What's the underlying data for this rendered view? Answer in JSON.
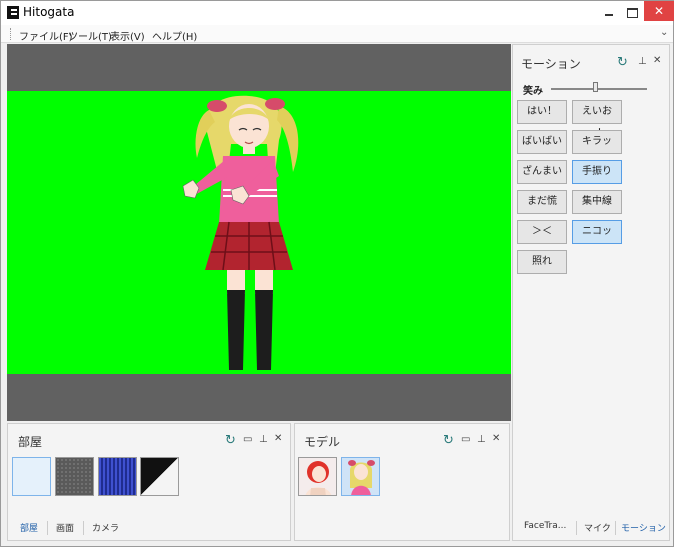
{
  "window": {
    "title": "Hitogata",
    "close_glyph": "✕"
  },
  "menu": [
    "ファイル(F)",
    "ツール(T)",
    "表示(V)",
    "ヘルプ(H)"
  ],
  "menu_overflow_glyph": "⌄",
  "panel_icons": {
    "refresh": "↻",
    "window": "▭",
    "pin": "⊥",
    "close": "✕"
  },
  "colors": {
    "chroma_key": "#00ff00",
    "viewport_bg": "#616161",
    "accent_tab": "#1f5fa8",
    "selected_button": "#cce4f7"
  },
  "motion_panel": {
    "title": "モーション",
    "slider": {
      "label": "笑み",
      "value_fraction": 0.45
    },
    "buttons": [
      {
        "label": "はい！",
        "selected": false
      },
      {
        "label": "えいおー！",
        "selected": false
      },
      {
        "label": "ばいばい",
        "selected": false
      },
      {
        "label": "キラッ",
        "selected": false
      },
      {
        "label": "ざんまい",
        "selected": false
      },
      {
        "label": "手振り",
        "selected": true
      },
      {
        "label": "まだ慌",
        "selected": false
      },
      {
        "label": "集中線",
        "selected": false
      },
      {
        "label": "＞＜",
        "selected": false
      },
      {
        "label": "ニコッ",
        "selected": true
      },
      {
        "label": "照れ",
        "selected": false
      }
    ],
    "tabs": [
      "FaceTra...",
      "マイク",
      "モーション"
    ],
    "active_tab": 2
  },
  "room_panel": {
    "title": "部屋",
    "thumbnails": [
      "blank-room",
      "gray-floor",
      "blue-floor",
      "black-white-floor"
    ],
    "selected_thumbnail": 0,
    "tabs": [
      "部屋",
      "画面",
      "カメラ"
    ],
    "active_tab": 0
  },
  "model_panel": {
    "title": "モデル",
    "thumbnails": [
      "red-hair-model",
      "blonde-model"
    ],
    "selected_thumbnail": 1
  }
}
